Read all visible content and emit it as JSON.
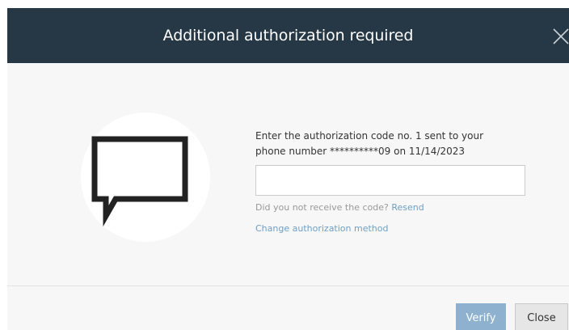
{
  "dialog": {
    "title": "Additional authorization required",
    "close_icon": "close-icon",
    "message_icon": "speech-bubble-icon",
    "prompt_line1": "Enter the authorization code no. 1 sent to your",
    "prompt_line2": "phone number **********09 on 11/14/2023",
    "code_input": {
      "value": "",
      "placeholder": ""
    },
    "not_received_text": "Did you not receive the code?",
    "resend_label": "Resend",
    "change_method_label": "Change authorization method",
    "verify_label": "Verify",
    "close_label": "Close"
  },
  "colors": {
    "header_bg": "#263746",
    "dialog_bg": "#f7f7f7",
    "link": "#6f9fc6",
    "primary_button": "#8db1cf",
    "secondary_button": "#e6e6e6"
  }
}
